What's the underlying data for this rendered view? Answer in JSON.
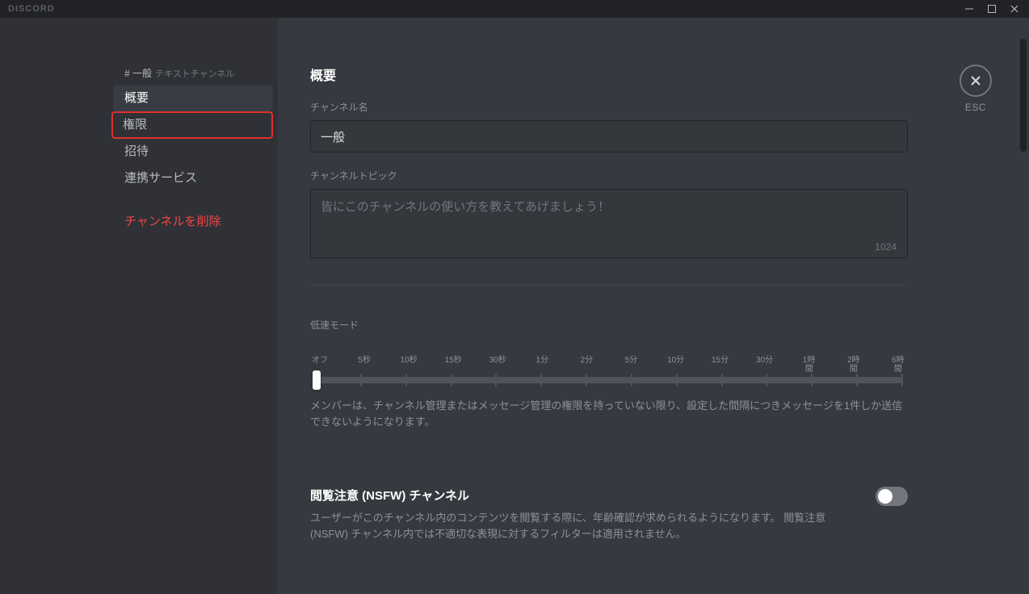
{
  "titlebar": {
    "logo": "DISCORD"
  },
  "sidebar": {
    "channel_hash": "# ",
    "channel_name": "一般",
    "channel_type": "テキストチャンネル",
    "items": [
      {
        "label": "概要"
      },
      {
        "label": "権限"
      },
      {
        "label": "招待"
      },
      {
        "label": "連携サービス"
      }
    ],
    "delete_label": "チャンネルを削除"
  },
  "content": {
    "heading": "概要",
    "channel_name_label": "チャンネル名",
    "channel_name_value": "一般",
    "channel_topic_label": "チャンネルトピック",
    "channel_topic_placeholder": "皆にこのチャンネルの使い方を教えてあげましょう！",
    "channel_topic_value": "",
    "topic_max_chars": "1024",
    "slowmode": {
      "label": "低速モード",
      "ticks": [
        "オフ",
        "5秒",
        "10秒",
        "15秒",
        "30秒",
        "1分",
        "2分",
        "5分",
        "10分",
        "15分",
        "30分",
        "1時\n間",
        "2時\n間",
        "6時\n間"
      ],
      "help": "メンバーは、チャンネル管理またはメッセージ管理の権限を持っていない限り、設定した間隔につきメッセージを1件しか送信できないようになります。"
    },
    "nsfw": {
      "title": "閲覧注意 (NSFW) チャンネル",
      "desc": "ユーザーがこのチャンネル内のコンテンツを閲覧する際に、年齢確認が求められるようになります。 閲覧注意 (NSFW) チャンネル内では不適切な表現に対するフィルターは適用されません。"
    }
  },
  "close": {
    "esc_label": "ESC"
  }
}
